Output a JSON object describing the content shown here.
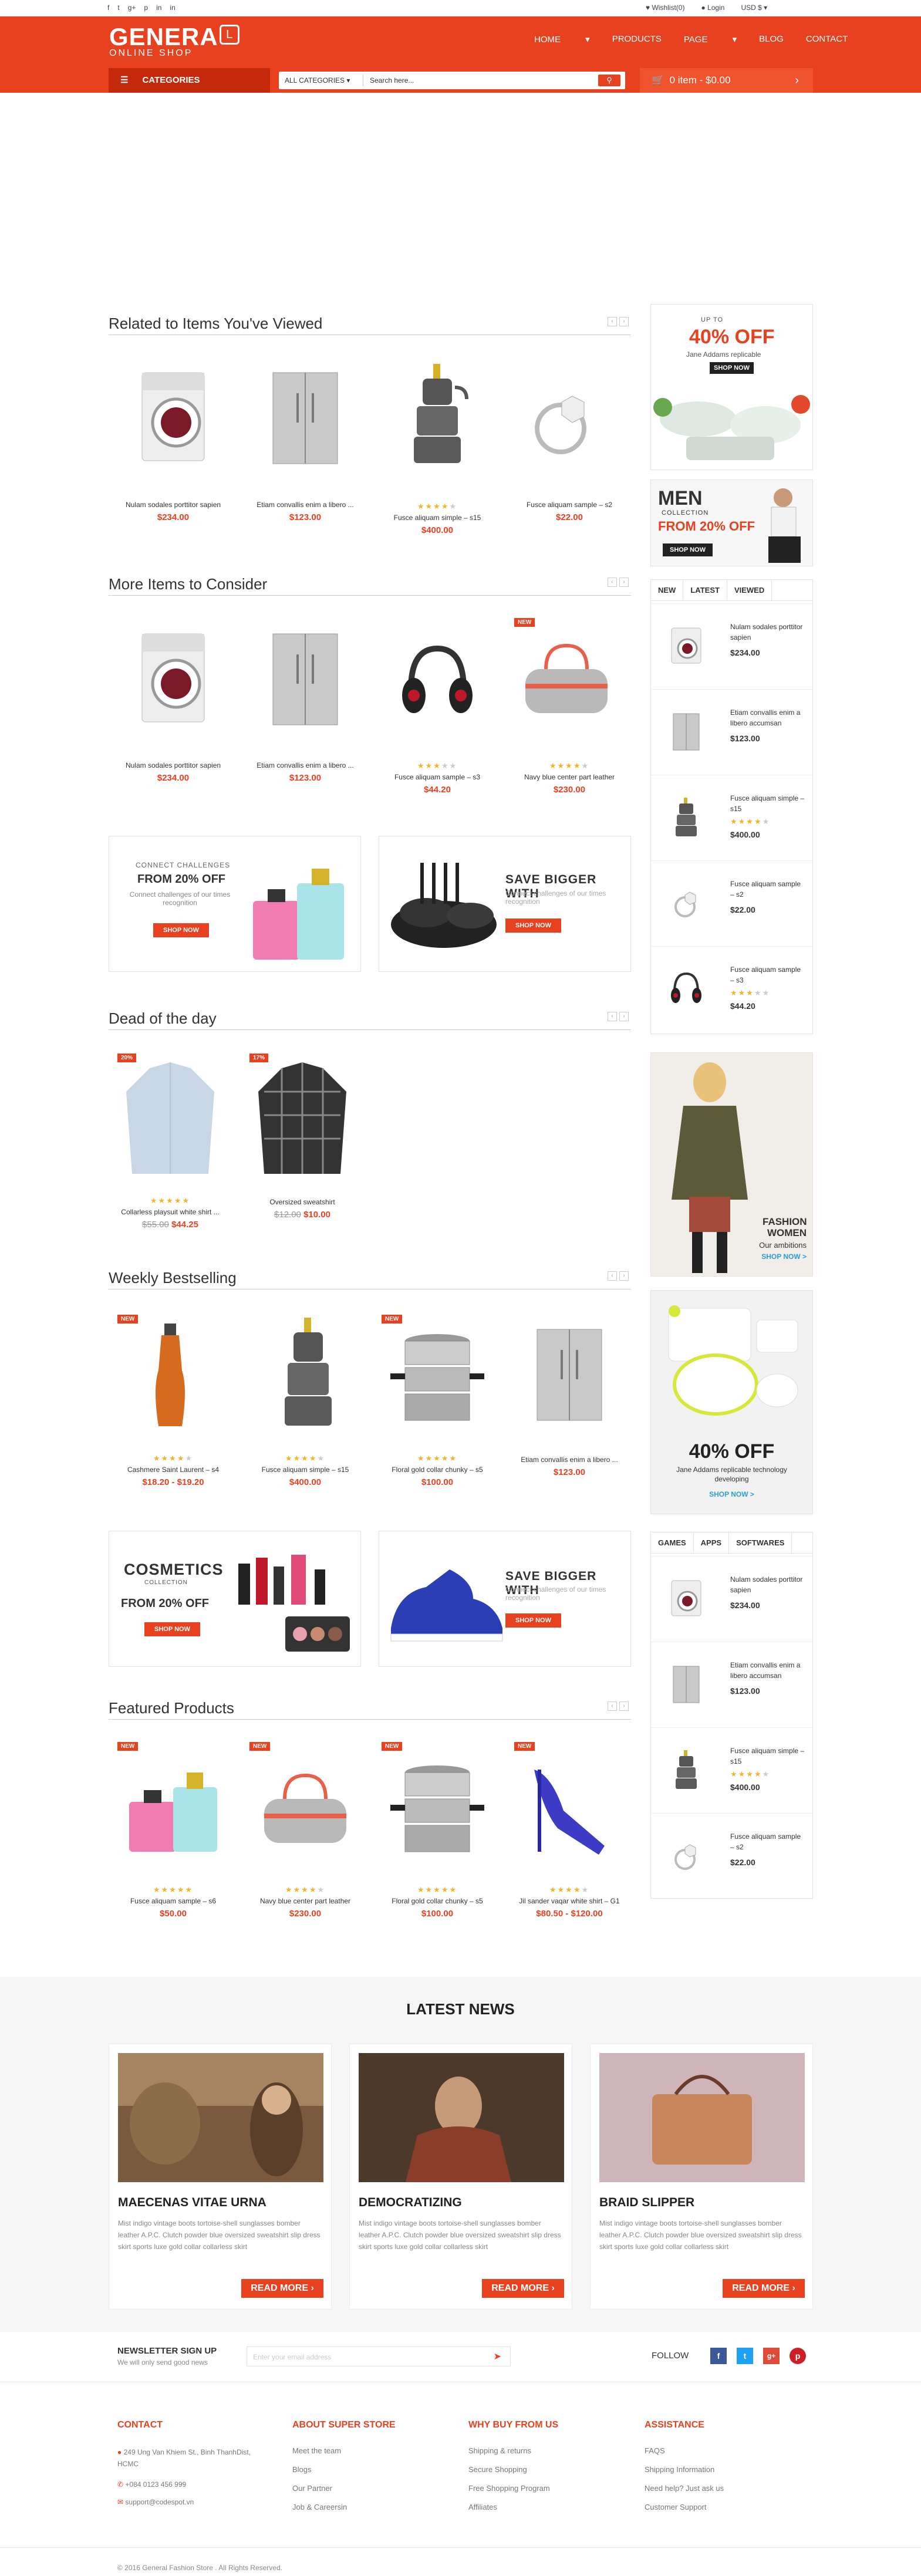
{
  "topbar": {
    "social": [
      "f",
      "t",
      "g+",
      "p",
      "in",
      "in"
    ],
    "wishlist": "Wishlist(0)",
    "login": "Login",
    "currency": "USD $"
  },
  "logo": {
    "main": "GENERA",
    "small": "ONLINE SHOP",
    "bag": "L"
  },
  "nav": [
    "HOME",
    "PRODUCTS",
    "PAGE",
    "BLOG",
    "CONTACT"
  ],
  "categories": "CATEGORIES",
  "search": {
    "dropdown": "ALL CATEGORIES",
    "placeholder": "Search here..."
  },
  "cart": {
    "label": "0 item - $0.00"
  },
  "sections": {
    "related": {
      "title": "Related to Items You've Viewed",
      "items": [
        {
          "name": "Nulam sodales porttitor sapien",
          "price": "$234.00"
        },
        {
          "name": "Etiam convallis enim a libero ...",
          "price": "$123.00"
        },
        {
          "name": "Fusce aliquam simple – s15",
          "price": "$400.00",
          "stars": 4
        },
        {
          "name": "Fusce aliquam sample – s2",
          "price": "$22.00"
        }
      ]
    },
    "more": {
      "title": "More Items to Consider",
      "items": [
        {
          "name": "Nulam sodales porttitor sapien",
          "price": "$234.00"
        },
        {
          "name": "Etiam convallis enim a libero ...",
          "price": "$123.00"
        },
        {
          "name": "Fusce aliquam sample – s3",
          "price": "$44.20",
          "stars": 3
        },
        {
          "name": "Navy blue center part leather",
          "price": "$230.00",
          "stars": 4,
          "badge": "NEW"
        }
      ]
    },
    "deal": {
      "title": "Dead of the day",
      "items": [
        {
          "name": "Collarless playsuit white shirt ...",
          "old": "$55.00",
          "price": "$44.25",
          "stars": 5,
          "badge": "20%"
        },
        {
          "name": "Oversized sweatshirt",
          "old": "$12.00",
          "price": "$10.00",
          "badge": "17%"
        }
      ]
    },
    "weekly": {
      "title": "Weekly Bestselling",
      "items": [
        {
          "name": "Cashmere Saint Laurent – s4",
          "price": "$18.20 - $19.20",
          "stars": 4,
          "badge": "NEW"
        },
        {
          "name": "Fusce aliquam simple – s15",
          "price": "$400.00",
          "stars": 4
        },
        {
          "name": "Floral gold collar chunky – s5",
          "price": "$100.00",
          "stars": 5,
          "badge": "NEW"
        },
        {
          "name": "Etiam convallis enim a libero ...",
          "price": "$123.00"
        }
      ]
    },
    "featured": {
      "title": "Featured Products",
      "items": [
        {
          "name": "Fusce aliquam sample – s6",
          "price": "$50.00",
          "stars": 5,
          "badge": "NEW"
        },
        {
          "name": "Navy blue center part leather",
          "price": "$230.00",
          "stars": 4,
          "badge": "NEW"
        },
        {
          "name": "Floral gold collar chunky – s5",
          "price": "$100.00",
          "stars": 5,
          "badge": "NEW"
        },
        {
          "name": "Jil sander vaqar white shirt – G1",
          "price": "$80.50 - $120.00",
          "stars": 4,
          "badge": "NEW"
        }
      ]
    }
  },
  "banners": {
    "b1": {
      "top": "CONNECT CHALLENGES",
      "big": "FROM 20% OFF",
      "sub": "Connect challenges of our times recognition",
      "btn": "SHOP NOW"
    },
    "b2": {
      "big": "SAVE BIGGER WITH",
      "sub": "Connect challenges of our times recognition",
      "btn": "SHOP NOW"
    },
    "b3": {
      "big": "COSMETICS",
      "top": "COLLECTION",
      "off": "FROM 20% OFF",
      "btn": "SHOP NOW"
    },
    "b4": {
      "big": "SAVE BIGGER WITH",
      "sub": "Connect challenges of our times recognition",
      "btn": "SHOP NOW"
    }
  },
  "side": {
    "ad1": {
      "top": "UP TO",
      "big": "40% OFF",
      "sub": "Jane Addams replicable",
      "btn": "SHOP NOW"
    },
    "ad2": {
      "big": "MEN",
      "top": "COLLECTION",
      "off": "FROM 20% OFF",
      "btn": "SHOP NOW"
    },
    "tabs1": [
      "NEW",
      "LATEST",
      "VIEWED"
    ],
    "list1": [
      {
        "name": "Nulam sodales porttitor sapien",
        "price": "$234.00"
      },
      {
        "name": "Etiam convallis enim a libero accumsan",
        "price": "$123.00"
      },
      {
        "name": "Fusce aliquam simple – s15",
        "price": "$400.00",
        "stars": 4
      },
      {
        "name": "Fusce aliquam sample – s2",
        "price": "$22.00"
      },
      {
        "name": "Fusce aliquam sample – s3",
        "price": "$44.20",
        "stars": 3
      }
    ],
    "ad3": {
      "big": "FASHION",
      "big2": "WOMEN",
      "sub": "Our ambitions",
      "btn": "SHOP NOW >"
    },
    "ad4": {
      "big": "40% OFF",
      "sub": "Jane Addams replicable technology developing",
      "btn": "SHOP NOW >"
    },
    "tabs2": [
      "GAMES",
      "APPS",
      "SOFTWARES"
    ],
    "list2": [
      {
        "name": "Nulam sodales porttitor sapien",
        "price": "$234.00"
      },
      {
        "name": "Etiam convallis enim a libero accumsan",
        "price": "$123.00"
      },
      {
        "name": "Fusce aliquam simple – s15",
        "price": "$400.00",
        "stars": 4
      },
      {
        "name": "Fusce aliquam sample – s2",
        "price": "$22.00"
      }
    ]
  },
  "news": {
    "title": "LATEST NEWS",
    "items": [
      {
        "title": "MAECENAS VITAE URNA",
        "text": "Mist indigo vintage boots tortoise-shell sunglasses bomber leather A.P.C. Clutch powder blue oversized sweatshirt slip dress skirt sports luxe gold collar collarless skirt",
        "btn": "READ MORE"
      },
      {
        "title": "DEMOCRATIZING",
        "text": "Mist indigo vintage boots tortoise-shell sunglasses bomber leather A.P.C. Clutch powder blue oversized sweatshirt slip dress skirt sports luxe gold collar collarless skirt",
        "btn": "READ MORE"
      },
      {
        "title": "BRAID SLIPPER",
        "text": "Mist indigo vintage boots tortoise-shell sunglasses bomber leather A.P.C. Clutch powder blue oversized sweatshirt slip dress skirt sports luxe gold collar collarless skirt",
        "btn": "READ MORE"
      }
    ]
  },
  "newsletter": {
    "title": "NEWSLETTER SIGN UP",
    "sub": "We will only send good news",
    "placeholder": "Enter your email address",
    "follow": "FOLLOW"
  },
  "footer": {
    "contact": {
      "title": "CONTACT",
      "address": "249 Ung Van Khiem St., Binh ThanhDist, HCMC",
      "phone": "+084 0123 456 999",
      "email": "support@codespot.vn"
    },
    "about": {
      "title": "ABOUT SUPER STORE",
      "links": [
        "Meet the team",
        "Blogs",
        "Our Partner",
        "Job & Careersin"
      ]
    },
    "why": {
      "title": "WHY BUY FROM US",
      "links": [
        "Shipping & returns",
        "Secure Shopping",
        "Free Shopping Program",
        "Affiliates"
      ]
    },
    "assist": {
      "title": "ASSISTANCE",
      "links": [
        "FAQS",
        "Shipping Information",
        "Need help? Just ask us",
        "Customer Support"
      ]
    },
    "copyright": "© 2016 General Fashion Store . All Rights Reserved."
  },
  "colors": {
    "accent": "#e8411f",
    "dark_accent": "#c5290c",
    "star": "#f2b52a"
  }
}
